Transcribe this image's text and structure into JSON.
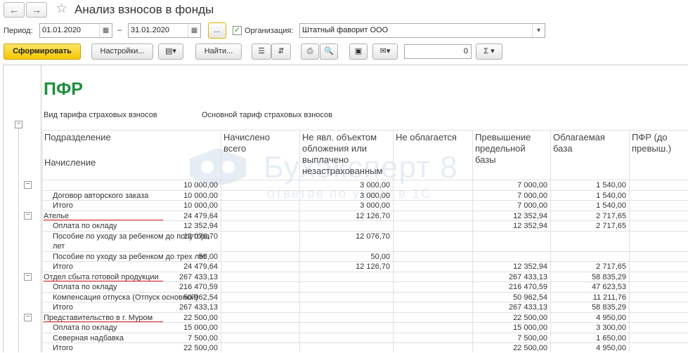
{
  "window": {
    "title": "Анализ взносов в фонды",
    "back_icon": "←",
    "forward_icon": "→"
  },
  "filters": {
    "period_label": "Период:",
    "date_from": "01.01.2020",
    "dash": "–",
    "date_to": "31.01.2020",
    "more_label": "...",
    "org_label": "Организация:",
    "org_value": "Штатный фаворит ООО",
    "org_checked": true
  },
  "toolbar": {
    "generate_label": "Сформировать",
    "settings_label": "Настройки...",
    "find_label": "Найти...",
    "sum_value": "0",
    "sigma": "Σ"
  },
  "report": {
    "title": "ПФР",
    "tariff_label": "Вид тарифа страховых взносов",
    "tariff_value": "Основной тариф страховых взносов",
    "headers": {
      "division": "Подразделение",
      "accrual": "Начисление",
      "total": [
        "Начислено",
        "всего"
      ],
      "nonobject": [
        "Не явл. объектом",
        "обложения или",
        "выплачено",
        "незастрахованным"
      ],
      "nontaxable": [
        "Не облагается"
      ],
      "excess": [
        "Превышение",
        "предельной",
        "базы"
      ],
      "base": [
        "Облагаемая",
        "база"
      ],
      "pfr": [
        "ПФР (до",
        "превыш.)"
      ]
    },
    "rows": [
      {
        "name": "",
        "total": "10 000,00",
        "nontax": "3 000,00",
        "base": "7 000,00",
        "pfr": "1 540,00",
        "indent": 0,
        "toggle": true
      },
      {
        "name": "Договор авторского заказа",
        "total": "10 000,00",
        "nontax": "3 000,00",
        "base": "7 000,00",
        "pfr": "1 540,00",
        "indent": 1,
        "toggle": false
      },
      {
        "name": "Итого",
        "total": "10 000,00",
        "nontax": "3 000,00",
        "base": "7 000,00",
        "pfr": "1 540,00",
        "indent": 1,
        "toggle": false
      },
      {
        "name": "Ателье",
        "total": "24 479,64",
        "nontax": "12 126,70",
        "base": "12 352,94",
        "pfr": "2 717,65",
        "indent": 0,
        "toggle": true,
        "underline": true
      },
      {
        "name": "Оплата по окладу",
        "total": "12 352,94",
        "nontax": "",
        "base": "12 352,94",
        "pfr": "2 717,65",
        "indent": 1,
        "toggle": false
      },
      {
        "name": "Пособие по уходу за ребенком до полутора",
        "name2": "лет",
        "total": "12 076,70",
        "nontax": "12 076,70",
        "base": "",
        "pfr": "",
        "indent": 1,
        "toggle": false
      },
      {
        "name": "Пособие по уходу за ребенком до трех лет",
        "total": "50,00",
        "nontax": "50,00",
        "base": "",
        "pfr": "",
        "indent": 1,
        "toggle": false
      },
      {
        "name": "Итого",
        "total": "24 479,64",
        "nontax": "12 126,70",
        "base": "12 352,94",
        "pfr": "2 717,65",
        "indent": 1,
        "toggle": false
      },
      {
        "name": "Отдел сбыта готовой продукции",
        "total": "267 433,13",
        "nontax": "",
        "base": "267 433,13",
        "pfr": "58 835,29",
        "indent": 0,
        "toggle": true,
        "underline": true
      },
      {
        "name": "Оплата по окладу",
        "total": "216 470,59",
        "nontax": "",
        "base": "216 470,59",
        "pfr": "47 623,53",
        "indent": 1,
        "toggle": false
      },
      {
        "name": "Компенсация отпуска (Отпуск основной)",
        "total": "50 962,54",
        "nontax": "",
        "base": "50 962,54",
        "pfr": "11 211,76",
        "indent": 1,
        "toggle": false
      },
      {
        "name": "Итого",
        "total": "267 433,13",
        "nontax": "",
        "base": "267 433,13",
        "pfr": "58 835,29",
        "indent": 1,
        "toggle": false
      },
      {
        "name": "Представительство в г. Муром",
        "total": "22 500,00",
        "nontax": "",
        "base": "22 500,00",
        "pfr": "4 950,00",
        "indent": 0,
        "toggle": true,
        "underline": true
      },
      {
        "name": "Оплата по окладу",
        "total": "15 000,00",
        "nontax": "",
        "base": "15 000,00",
        "pfr": "3 300,00",
        "indent": 1,
        "toggle": false
      },
      {
        "name": "Северная надбавка",
        "total": "7 500,00",
        "nontax": "",
        "base": "7 500,00",
        "pfr": "1 650,00",
        "indent": 1,
        "toggle": false
      },
      {
        "name": "Итого",
        "total": "22 500,00",
        "nontax": "",
        "base": "22 500,00",
        "pfr": "4 950,00",
        "indent": 1,
        "toggle": false
      }
    ]
  },
  "watermark": {
    "title": "Бухэксперт 8",
    "subtitle": "ответов по учёту в 1С"
  }
}
